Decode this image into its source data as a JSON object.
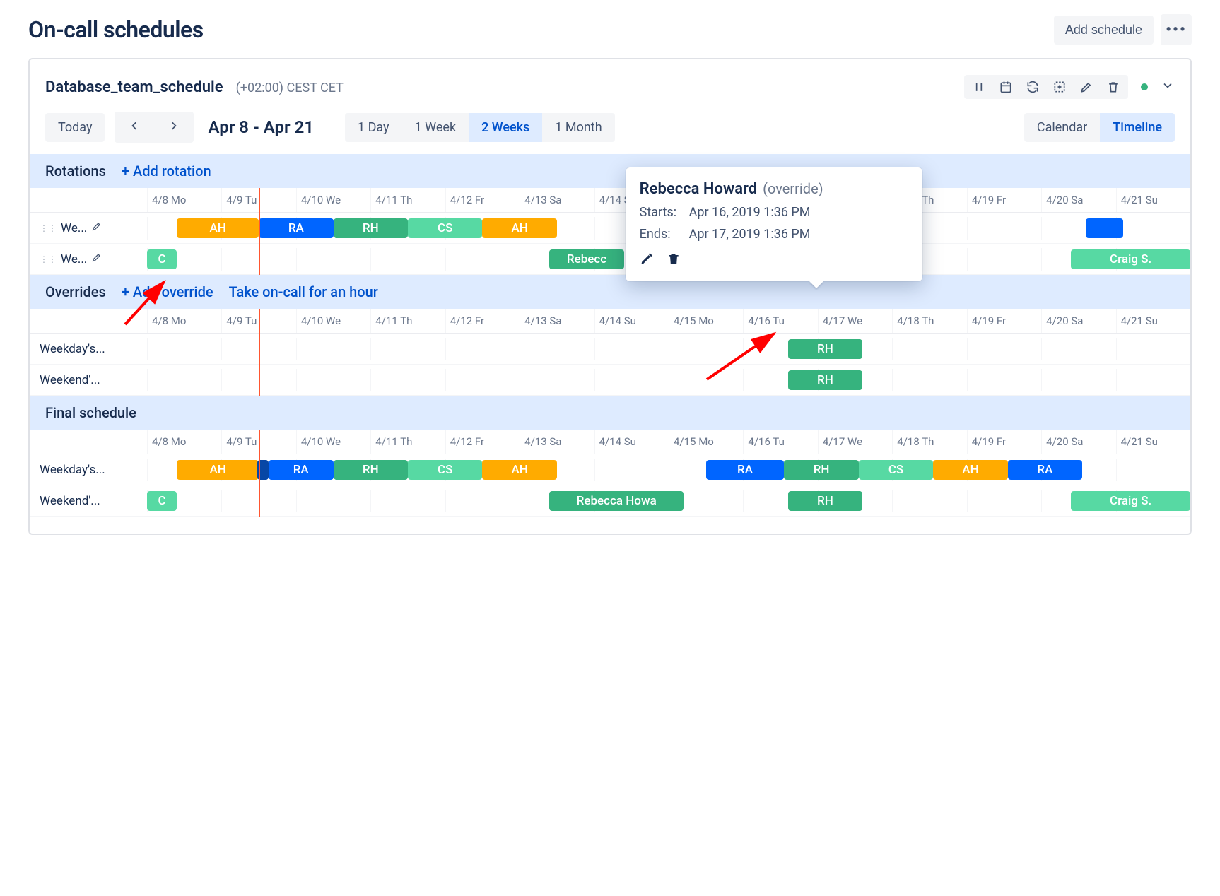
{
  "page_title": "On-call schedules",
  "add_schedule_label": "Add schedule",
  "schedule": {
    "name": "Database_team_schedule",
    "timezone": "(+02:00) CEST CET"
  },
  "controls": {
    "today": "Today",
    "range": "Apr 8 - Apr 21",
    "span_options": [
      "1 Day",
      "1 Week",
      "2 Weeks",
      "1 Month"
    ],
    "span_active": "2 Weeks",
    "view_options": [
      "Calendar",
      "Timeline"
    ],
    "view_active": "Timeline"
  },
  "days": [
    "4/8 Mo",
    "4/9 Tu",
    "4/10 We",
    "4/11 Th",
    "4/12 Fr",
    "4/13 Sa",
    "4/14 Su",
    "4/15 Mo",
    "4/16 Tu",
    "4/17 We",
    "4/18 Th",
    "4/19 Fr",
    "4/20 Sa",
    "4/21 Su"
  ],
  "rotations": {
    "title": "Rotations",
    "add_label": "+ Add rotation",
    "rows": [
      {
        "label": "We...",
        "chips": [
          {
            "text": "AH",
            "color": "c-orange",
            "start": 0.4,
            "span": 1.1
          },
          {
            "text": "RA",
            "color": "c-blue",
            "start": 1.5,
            "span": 1.0
          },
          {
            "text": "RH",
            "color": "c-green",
            "start": 2.5,
            "span": 1.0
          },
          {
            "text": "CS",
            "color": "c-lightgreen",
            "start": 3.5,
            "span": 1.0
          },
          {
            "text": "AH",
            "color": "c-orange",
            "start": 4.5,
            "span": 1.0
          },
          {
            "text": "",
            "color": "c-blue",
            "start": 12.6,
            "span": 0.5
          }
        ]
      },
      {
        "label": "We...",
        "chips": [
          {
            "text": "C",
            "color": "c-lightgreen",
            "start": 0.0,
            "span": 0.4
          },
          {
            "text": "Rebecc",
            "color": "c-green",
            "start": 5.4,
            "span": 1.0
          },
          {
            "text": "Craig S.",
            "color": "c-lightgreen",
            "start": 12.4,
            "span": 1.6
          }
        ]
      }
    ]
  },
  "overrides": {
    "title": "Overrides",
    "add_label": "+ Add override",
    "take_label": "Take on-call for an hour",
    "rows": [
      {
        "label": "Weekday's...",
        "chips": [
          {
            "text": "RH",
            "color": "c-green",
            "start": 8.6,
            "span": 1.0
          }
        ]
      },
      {
        "label": "Weekend'...",
        "chips": [
          {
            "text": "RH",
            "color": "c-green",
            "start": 8.6,
            "span": 1.0
          }
        ]
      }
    ]
  },
  "final": {
    "title": "Final schedule",
    "rows": [
      {
        "label": "Weekday's...",
        "chips": [
          {
            "text": "AH",
            "color": "c-orange",
            "start": 0.4,
            "span": 1.1
          },
          {
            "text": "",
            "color": "c-darkblue",
            "start": 1.48,
            "span": 0.15
          },
          {
            "text": "RA",
            "color": "c-blue",
            "start": 1.63,
            "span": 0.87
          },
          {
            "text": "RH",
            "color": "c-green",
            "start": 2.5,
            "span": 1.0
          },
          {
            "text": "CS",
            "color": "c-lightgreen",
            "start": 3.5,
            "span": 1.0
          },
          {
            "text": "AH",
            "color": "c-orange",
            "start": 4.5,
            "span": 1.0
          },
          {
            "text": "RA",
            "color": "c-blue",
            "start": 7.5,
            "span": 1.05
          },
          {
            "text": "RH",
            "color": "c-green",
            "start": 8.55,
            "span": 1.0
          },
          {
            "text": "CS",
            "color": "c-lightgreen",
            "start": 9.55,
            "span": 1.0
          },
          {
            "text": "AH",
            "color": "c-orange",
            "start": 10.55,
            "span": 1.0
          },
          {
            "text": "RA",
            "color": "c-blue",
            "start": 11.55,
            "span": 1.0
          }
        ]
      },
      {
        "label": "Weekend'...",
        "chips": [
          {
            "text": "C",
            "color": "c-lightgreen",
            "start": 0.0,
            "span": 0.4
          },
          {
            "text": "Rebecca Howa",
            "color": "c-green",
            "start": 5.4,
            "span": 1.8
          },
          {
            "text": "RH",
            "color": "c-green",
            "start": 8.6,
            "span": 1.0
          },
          {
            "text": "Craig S.",
            "color": "c-lightgreen",
            "start": 12.4,
            "span": 1.6
          }
        ]
      }
    ]
  },
  "popover": {
    "name": "Rebecca Howard",
    "tag": "(override)",
    "starts_label": "Starts:",
    "starts_value": "Apr 16, 2019 1:36 PM",
    "ends_label": "Ends:",
    "ends_value": "Apr 17, 2019 1:36 PM"
  },
  "now_line_day": 1.5
}
